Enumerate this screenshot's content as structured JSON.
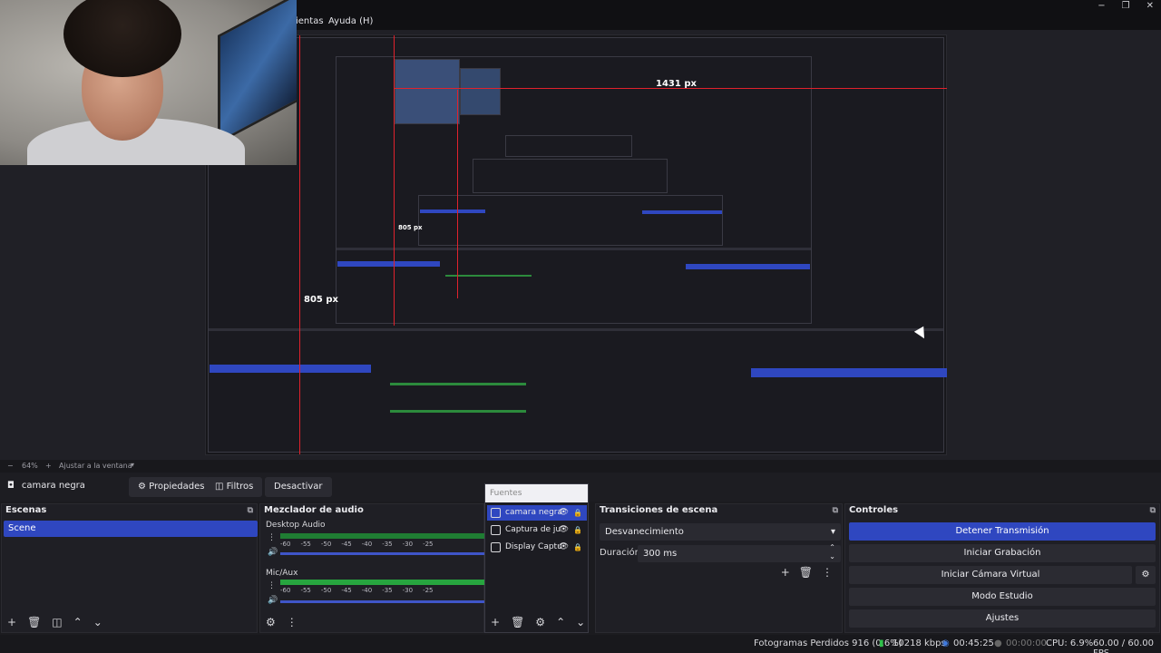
{
  "window": {
    "menu_visible": "ientas",
    "menu_help": "Ayuda (H)",
    "controls": [
      "−",
      "❐",
      "✕"
    ]
  },
  "preview": {
    "measure_h": "1431 px",
    "measure_v1": "805 px",
    "measure_v2": "805 px"
  },
  "zoom": {
    "minus": "−",
    "value": "64%",
    "plus": "+",
    "fit": "Ajustar a la ventana"
  },
  "toolbar": {
    "scene_name": "camara negra",
    "properties": "Propiedades",
    "filters": "Filtros",
    "deactivate": "Desactivar"
  },
  "scenes": {
    "title": "Escenas",
    "items": [
      "Scene"
    ]
  },
  "mixer": {
    "title": "Mezclador de audio",
    "channels": [
      {
        "name": "Desktop Audio",
        "scale": [
          "-60",
          "-55",
          "-50",
          "-45",
          "-40",
          "-35",
          "-30",
          "-25"
        ]
      },
      {
        "name": "Mic/Aux",
        "scale": [
          "-60",
          "-55",
          "-50",
          "-45",
          "-40",
          "-35",
          "-30",
          "-25"
        ]
      }
    ]
  },
  "sources": {
    "header": "Fuentes",
    "items": [
      {
        "name": "camara negra",
        "selected": true
      },
      {
        "name": "Captura de ju",
        "selected": false
      },
      {
        "name": "Display Captu",
        "selected": false
      }
    ]
  },
  "transitions": {
    "title": "Transiciones de escena",
    "selected": "Desvanecimiento",
    "duration_label": "Duración",
    "duration_value": "300 ms"
  },
  "controls": {
    "title": "Controles",
    "stop_stream": "Detener Transmisión",
    "start_record": "Iniciar Grabación",
    "start_vcam": "Iniciar Cámara Virtual",
    "studio_mode": "Modo Estudio",
    "settings": "Ajustes"
  },
  "status": {
    "dropped_frames": "Fotogramas Perdidos 916 (0.6%)",
    "bitrate": "10218 kbps",
    "live_time": "00:45:25",
    "rec_time": "00:00:00",
    "cpu": "CPU: 6.9%",
    "fps": "60.00 / 60.00 FPS"
  },
  "colors": {
    "accent": "#2f47c0",
    "meter_green": "#1f7d33",
    "measure_red": "#e0222c"
  }
}
